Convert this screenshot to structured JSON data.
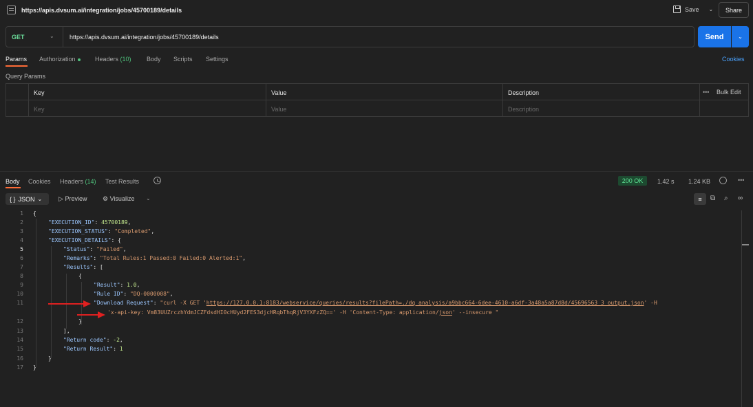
{
  "window": {
    "title": "https://apis.dvsum.ai/integration/jobs/45700189/details",
    "save_label": "Save",
    "share_label": "Share"
  },
  "request": {
    "method": "GET",
    "url": "https://apis.dvsum.ai/integration/jobs/45700189/details",
    "send_label": "Send",
    "tabs": [
      {
        "label": "Params"
      },
      {
        "label": "Authorization"
      },
      {
        "label": "Headers",
        "count": "(10)"
      },
      {
        "label": "Body"
      },
      {
        "label": "Scripts"
      },
      {
        "label": "Settings"
      }
    ],
    "cookies_label": "Cookies",
    "query_params_label": "Query Params",
    "table": {
      "headers": [
        "Key",
        "Value",
        "Description"
      ],
      "placeholders": [
        "Key",
        "Value",
        "Description"
      ],
      "bulk_edit": "Bulk Edit"
    }
  },
  "response": {
    "tabs": [
      {
        "label": "Body"
      },
      {
        "label": "Cookies"
      },
      {
        "label": "Headers",
        "count": "(14)"
      },
      {
        "label": "Test Results"
      }
    ],
    "status": "200 OK",
    "time": "1.42 s",
    "size": "1.24 KB",
    "format_label": "JSON",
    "preview_label": "Preview",
    "visualize_label": "Visualize",
    "lines": [
      "1",
      "2",
      "3",
      "4",
      "5",
      "6",
      "7",
      "8",
      "9",
      "10",
      "11",
      "12",
      "13",
      "14",
      "15",
      "16",
      "17"
    ],
    "code": {
      "l1": "{",
      "l2k": "\"EXECUTION_ID\"",
      "l2v": "45700189",
      "l3k": "\"EXECUTION_STATUS\"",
      "l3v": "\"Completed\"",
      "l4k": "\"EXECUTION_DETAILS\"",
      "l4v": "{",
      "l5k": "\"Status\"",
      "l5v": "\"Failed\"",
      "l6k": "\"Remarks\"",
      "l6v": "\"Total Rules:1 Passed:0 Failed:0 Alerted:1\"",
      "l7k": "\"Results\"",
      "l7v": "[",
      "l8": "{",
      "l9k": "\"Result\"",
      "l9v": "1.0",
      "l10k": "\"Rule ID\"",
      "l10v": "\"DQ-0000008\"",
      "l11k": "\"Download Request\"",
      "l11a": "\"curl -X GET '",
      "l11url": "https://127.0.0.1:8183/webservice/queries/results?filePath=./dq_analysis/a9bbc664-6dee-4610-a6df-3a48a5a87d8d/45696563_3_output.json",
      "l11b": "' -H",
      "l11c": "'x-api-key: Vm83UUZrczhYdmJCZFdsdHI0cHUyd2FES3djcHRqbThqRjV3YXFzZQ==' -H 'Content-Type: application/",
      "l11json": "json",
      "l11d": "' --insecure \"",
      "l12": "}",
      "l13": "],",
      "l14k": "\"Return code\"",
      "l14v": "-2",
      "l15k": "\"Return Result\"",
      "l15v": "1",
      "l16": "}",
      "l17": "}"
    }
  },
  "colors": {
    "accent": "#ff6c37",
    "send": "#1a73e8",
    "method": "#6bdd9a",
    "status_ok": "#5ee495",
    "arrow": "#e02020"
  }
}
